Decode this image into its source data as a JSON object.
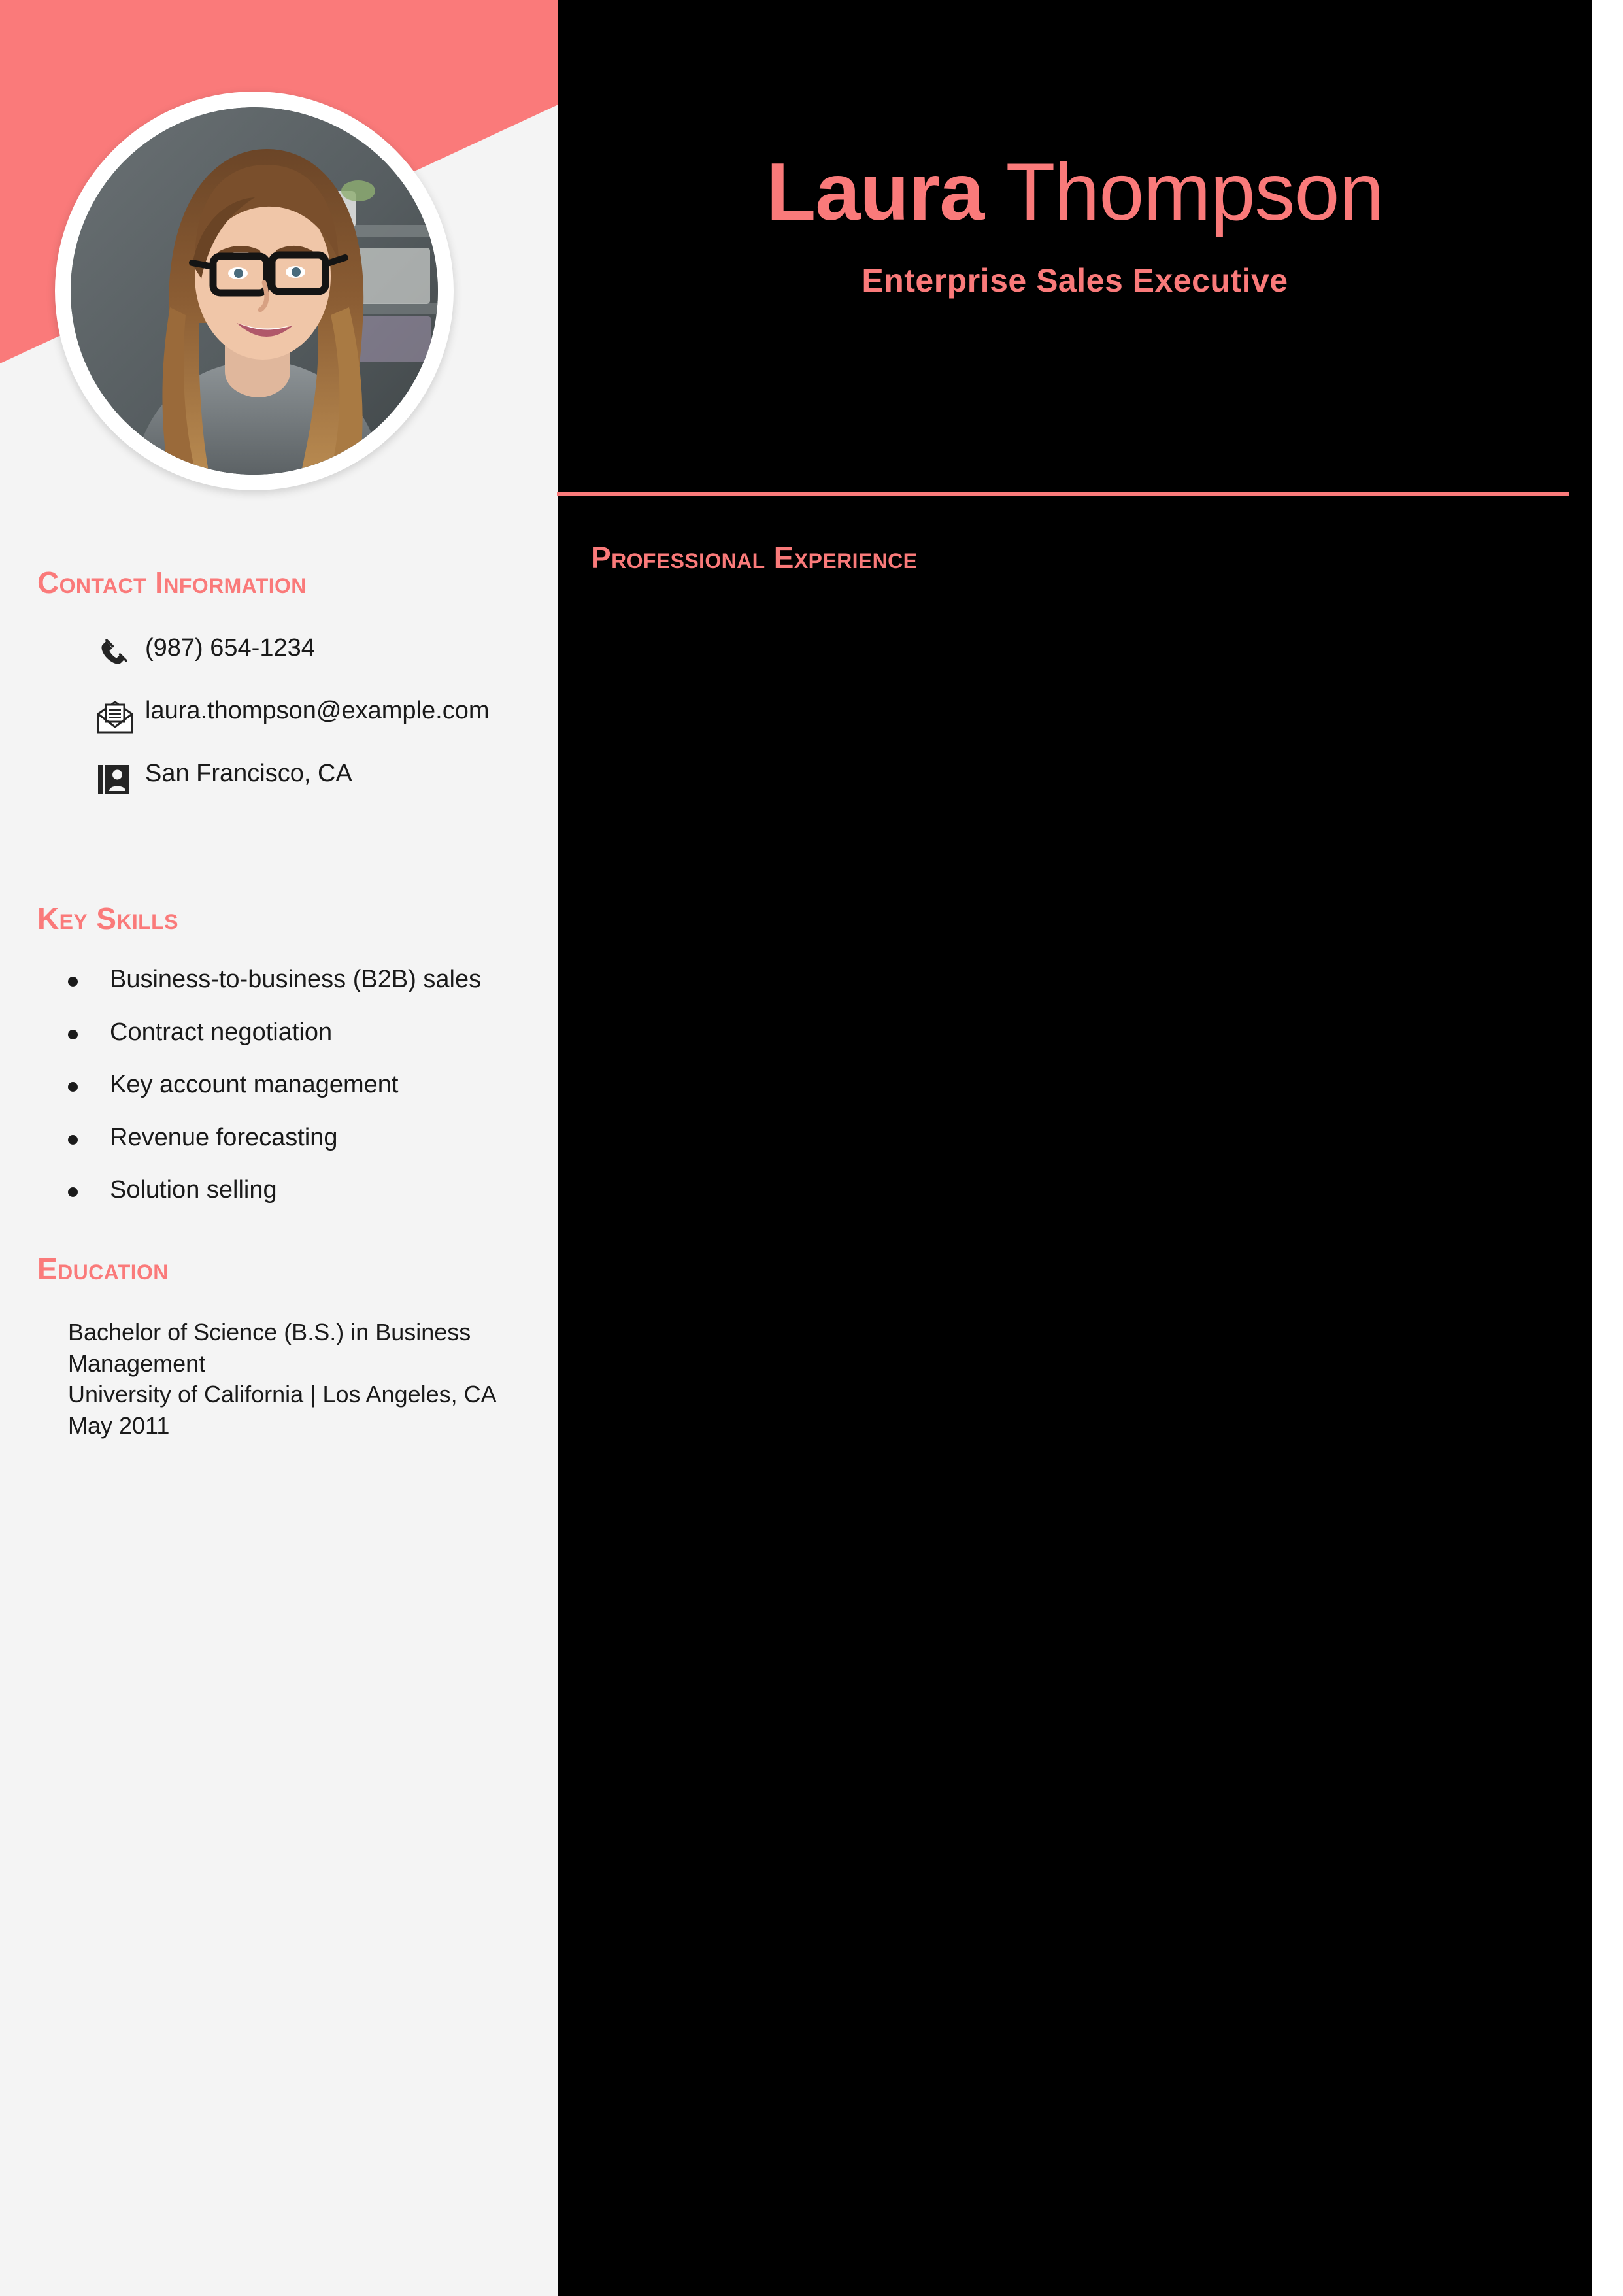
{
  "colors": {
    "accent": "#fa7a7a",
    "sidebar_bg": "#f4f4f4",
    "main_bg": "#000000",
    "body_text": "#1a1a1a"
  },
  "header": {
    "name_first": "Laura ",
    "name_last": "Thompson",
    "job_title": "Enterprise Sales Executive"
  },
  "sidebar": {
    "contact": {
      "heading": "Contact Information",
      "items": [
        {
          "icon": "phone-icon",
          "value": "(987) 654-1234"
        },
        {
          "icon": "envelope-icon",
          "value": "laura.thompson@example.com"
        },
        {
          "icon": "contact-card-icon",
          "value": "San Francisco, CA"
        }
      ]
    },
    "skills": {
      "heading": "Key Skills",
      "items": [
        "Business-to-business (B2B) sales",
        "Contract negotiation",
        "Key account management",
        "Revenue forecasting",
        "Solution selling"
      ]
    },
    "education": {
      "heading": "Education",
      "degree": "Bachelor of Science (B.S.) in Business Management",
      "school": "University of California | Los Angeles, CA May 2011"
    }
  },
  "main": {
    "experience": {
      "heading": "Professional Experience",
      "body": ""
    }
  }
}
